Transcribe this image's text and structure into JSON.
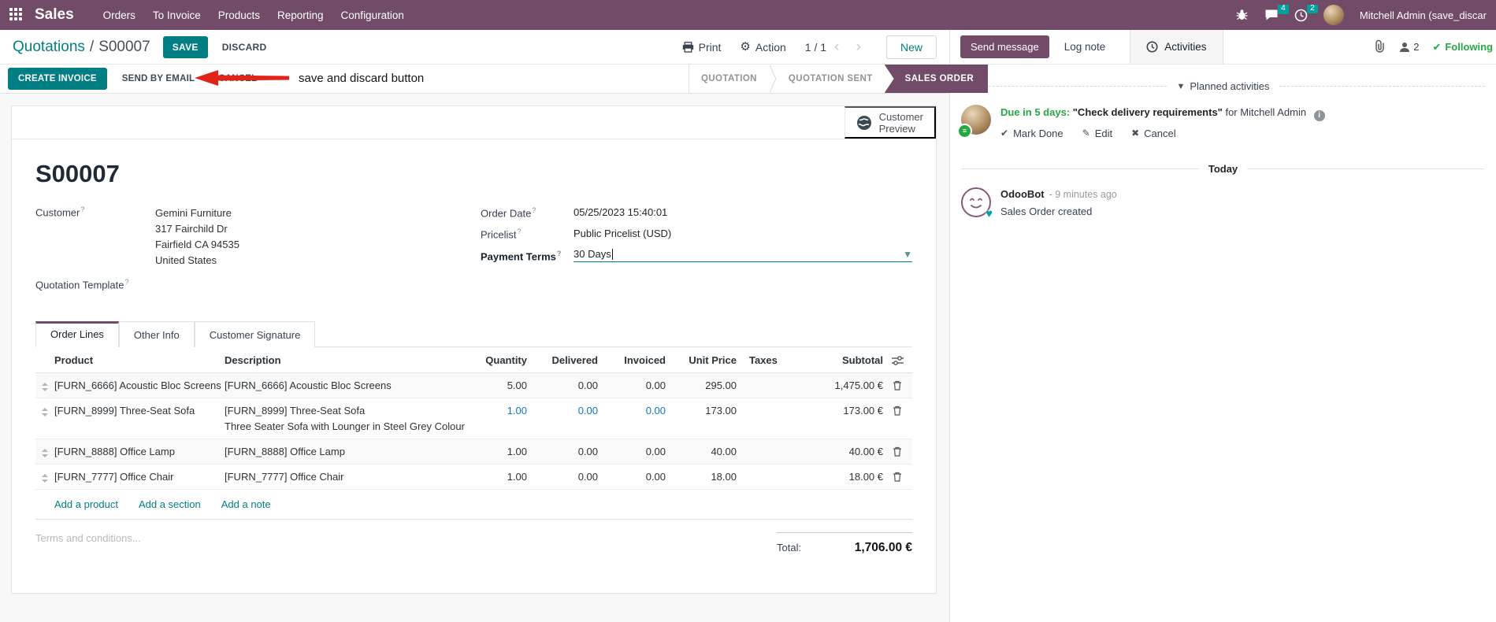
{
  "colors": {
    "brand": "#714B67",
    "accent": "#017E84",
    "badge": "#00A09D",
    "success": "#28a745",
    "edited_field": "#0b79bc",
    "annotation_red": "#e2231a"
  },
  "nav": {
    "app_name": "Sales",
    "items": [
      {
        "label": "Orders"
      },
      {
        "label": "To Invoice"
      },
      {
        "label": "Products"
      },
      {
        "label": "Reporting"
      },
      {
        "label": "Configuration"
      }
    ],
    "message_badge": "4",
    "activity_badge": "2",
    "user_name": "Mitchell Admin (save_discar"
  },
  "control": {
    "breadcrumb_parent": "Quotations",
    "separator": "/",
    "record": "S00007",
    "save": "SAVE",
    "discard": "DISCARD",
    "print": "Print",
    "action": "Action",
    "gear": "⚙",
    "pager": "1 / 1",
    "pager_arrows": "‹ ›",
    "new": "New"
  },
  "annotation": {
    "label": "save and discard button"
  },
  "statusbar": {
    "create_invoice": "CREATE INVOICE",
    "send_by_email": "SEND BY EMAIL",
    "cancel": "CANCEL",
    "steps": [
      {
        "label": "QUOTATION"
      },
      {
        "label": "QUOTATION SENT"
      },
      {
        "label": "SALES ORDER"
      }
    ]
  },
  "sheet": {
    "help": "?",
    "preview_line1": "Customer",
    "preview_line2": "Preview",
    "title": "S00007",
    "customer": {
      "label": "Customer",
      "name": "Gemini Furniture",
      "address1": "317 Fairchild Dr",
      "address2": "Fairfield CA 94535",
      "address3": "United States"
    },
    "quotation_template_label": "Quotation Template",
    "order_date": {
      "label": "Order Date",
      "value": "05/25/2023 15:40:01"
    },
    "pricelist": {
      "label": "Pricelist",
      "value": "Public Pricelist (USD)"
    },
    "payment_terms": {
      "label": "Payment Terms",
      "value": "30 Days"
    },
    "tabs": [
      {
        "label": "Order Lines"
      },
      {
        "label": "Other Info"
      },
      {
        "label": "Customer Signature"
      }
    ],
    "table": {
      "headers": {
        "product": "Product",
        "description": "Description",
        "quantity": "Quantity",
        "delivered": "Delivered",
        "invoiced": "Invoiced",
        "unit_price": "Unit Price",
        "taxes": "Taxes",
        "subtotal": "Subtotal"
      },
      "rows": [
        {
          "product": "[FURN_6666] Acoustic Bloc Screens",
          "description": "[FURN_6666] Acoustic Bloc Screens",
          "quantity": "5.00",
          "delivered": "0.00",
          "invoiced": "0.00",
          "unit_price": "295.00",
          "taxes": "",
          "subtotal": "1,475.00 €"
        },
        {
          "product": "[FURN_8999] Three-Seat Sofa",
          "description": "[FURN_8999] Three-Seat Sofa",
          "description2": "Three Seater Sofa with Lounger in Steel Grey Colour",
          "quantity": "1.00",
          "delivered": "0.00",
          "invoiced": "0.00",
          "unit_price": "173.00",
          "taxes": "",
          "subtotal": "173.00 €"
        },
        {
          "product": "[FURN_8888] Office Lamp",
          "description": "[FURN_8888] Office Lamp",
          "quantity": "1.00",
          "delivered": "0.00",
          "invoiced": "0.00",
          "unit_price": "40.00",
          "taxes": "",
          "subtotal": "40.00 €"
        },
        {
          "product": "[FURN_7777] Office Chair",
          "description": "[FURN_7777] Office Chair",
          "quantity": "1.00",
          "delivered": "0.00",
          "invoiced": "0.00",
          "unit_price": "18.00",
          "taxes": "",
          "subtotal": "18.00 €"
        }
      ],
      "add_product": "Add a product",
      "add_section": "Add a section",
      "add_note": "Add a note"
    },
    "terms_placeholder": "Terms and conditions...",
    "total_label": "Total:",
    "total_value": "1,706.00 €"
  },
  "chatter": {
    "send_message": "Send message",
    "log_note": "Log note",
    "activities_tab": "Activities",
    "followers_count": "2",
    "following": "Following",
    "following_check": "✔",
    "planned_title": "Planned activities",
    "activity": {
      "due": "Due in 5 days:",
      "summary": "\"Check delivery requirements\"",
      "assignee": "for Mitchell Admin",
      "info": "i",
      "mark_done": "Mark Done",
      "mark_done_icon": "✔",
      "edit": "Edit",
      "edit_icon": "✎",
      "cancel": "Cancel",
      "cancel_icon": "✖"
    },
    "today": "Today",
    "message": {
      "author": "OdooBot",
      "time": "- 9 minutes ago",
      "body": "Sales Order created"
    }
  }
}
